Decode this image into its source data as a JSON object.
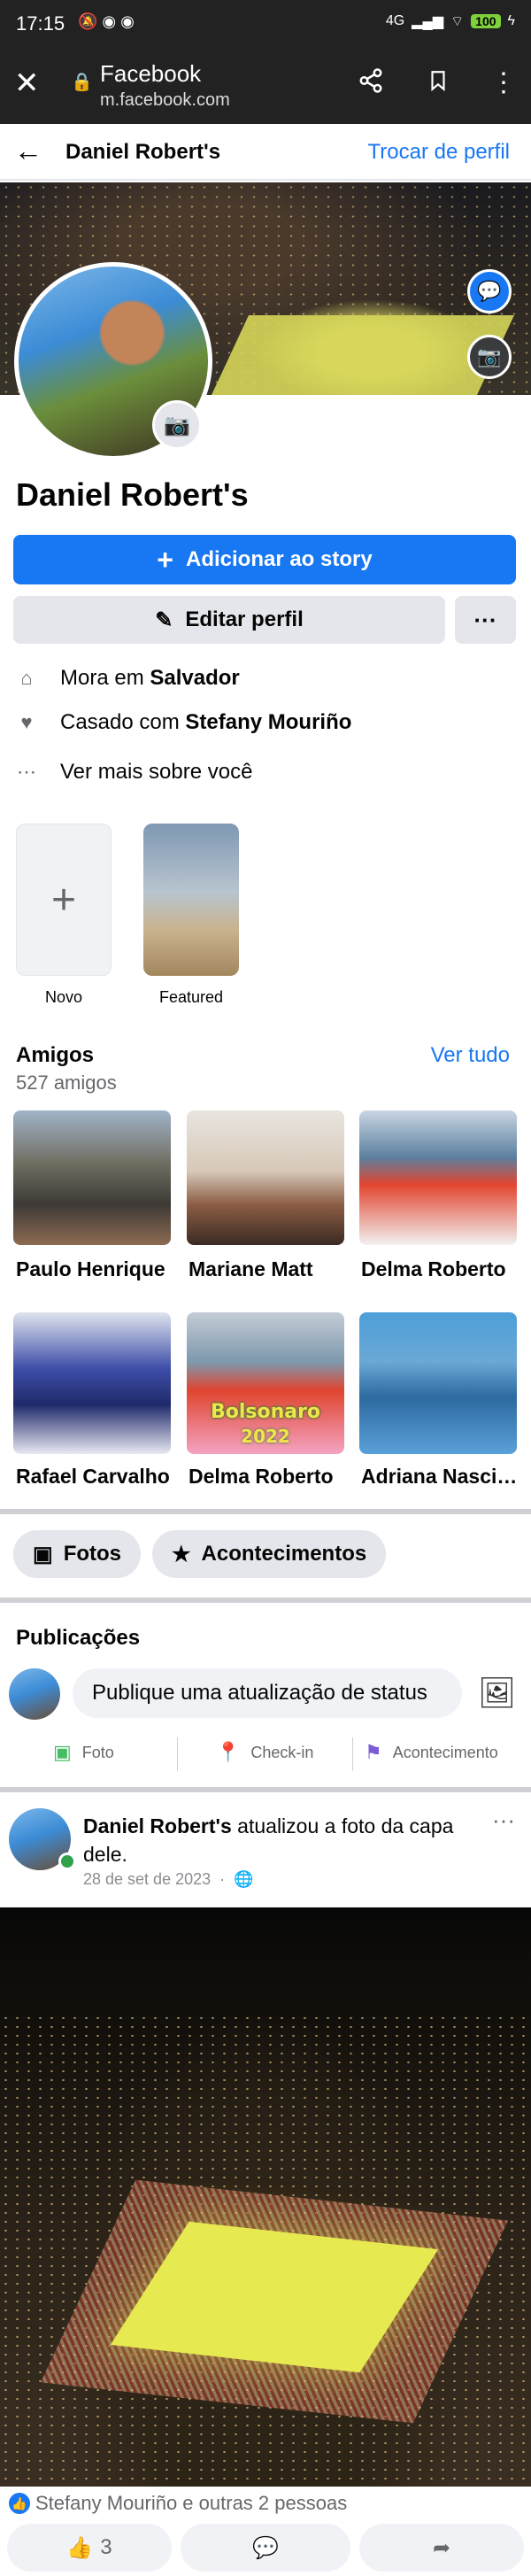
{
  "status_bar": {
    "time": "17:15",
    "network": "4G",
    "battery": "100"
  },
  "browser": {
    "site_title": "Facebook",
    "url": "m.facebook.com"
  },
  "header": {
    "profile_name": "Daniel Robert's",
    "switch_profile": "Trocar de perfil"
  },
  "profile": {
    "name": "Daniel Robert's",
    "add_story": "Adicionar ao story",
    "edit_profile": "Editar perfil",
    "more": "···"
  },
  "details": {
    "lives_prefix": "Mora em ",
    "lives_city": "Salvador",
    "married_prefix": "Casado com ",
    "married_to": "Stefany Mouriño",
    "see_more": "Ver mais sobre você"
  },
  "highlights": [
    {
      "label": "Novo"
    },
    {
      "label": "Featured"
    }
  ],
  "friends": {
    "title": "Amigos",
    "count": "527 amigos",
    "see_all": "Ver tudo",
    "items": [
      {
        "name": "Paulo Henrique"
      },
      {
        "name": "Mariane Matt"
      },
      {
        "name": "Delma Roberto"
      },
      {
        "name": "Rafael Carvalho"
      },
      {
        "name": "Delma Roberto"
      },
      {
        "name": "Adriana Nascimento"
      }
    ],
    "photo_caption_top": "Bolsonaro",
    "photo_caption_bottom": "2022"
  },
  "tabs": {
    "photos": "Fotos",
    "events": "Acontecimentos"
  },
  "publications": {
    "title": "Publicações",
    "composer_placeholder": "Publique uma atualização de status",
    "action_photo": "Foto",
    "action_checkin": "Check-in",
    "action_event": "Acontecimento"
  },
  "post": {
    "author": "Daniel Robert's",
    "action": " atualizou a foto da capa dele.",
    "date": "28 de set de 2023",
    "reactions": "Stefany Mouriño e outras 2 pessoas",
    "like_count": "3"
  },
  "colors": {
    "brand_blue": "#1877f2",
    "online_green": "#31a24c",
    "status_bar": "#222222"
  }
}
